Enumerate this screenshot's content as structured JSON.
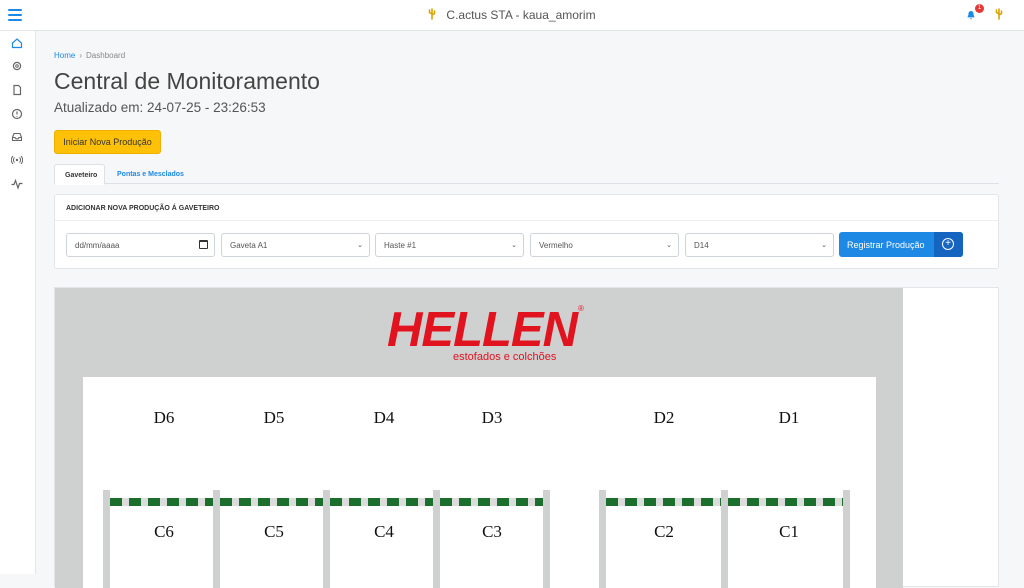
{
  "header": {
    "title": "C.actus STA - kaua_amorim",
    "notification_count": "1"
  },
  "sidebar": {
    "items": [
      "home-icon",
      "settings-icon",
      "document-icon",
      "info-icon",
      "inbox-icon",
      "broadcast-icon",
      "activity-icon"
    ]
  },
  "breadcrumb": {
    "home": "Home",
    "separator": "›",
    "current": "Dashboard"
  },
  "page": {
    "title": "Central de Monitoramento",
    "updated": "Atualizado em: 24-07-25 - 23:26:53",
    "start_button": "Iniciar Nova Produção"
  },
  "tabs": [
    {
      "label": "Gaveteiro",
      "active": true
    },
    {
      "label": "Pontas e Mesclados",
      "active": false
    }
  ],
  "form": {
    "heading": "ADICIONAR NOVA PRODUÇÃO Á GAVETEIRO",
    "date_placeholder": "dd/mm/aaaa",
    "gaveta": "Gaveta A1",
    "haste": "Haste #1",
    "cor": "Vermelho",
    "densidade": "D14",
    "submit": "Registrar Produção"
  },
  "map": {
    "brand": "HELLEN",
    "registered": "®",
    "tagline": "estofados e colchões",
    "d_labels": [
      "D6",
      "D5",
      "D4",
      "D3",
      "D2",
      "D1"
    ],
    "c_labels": [
      "C6",
      "C5",
      "C4",
      "C3",
      "C2",
      "C1"
    ]
  },
  "colors": {
    "accent": "#1e88e5",
    "warning": "#ffc107",
    "brand_red": "#e0131f",
    "rail_green": "#1b6e2c"
  }
}
